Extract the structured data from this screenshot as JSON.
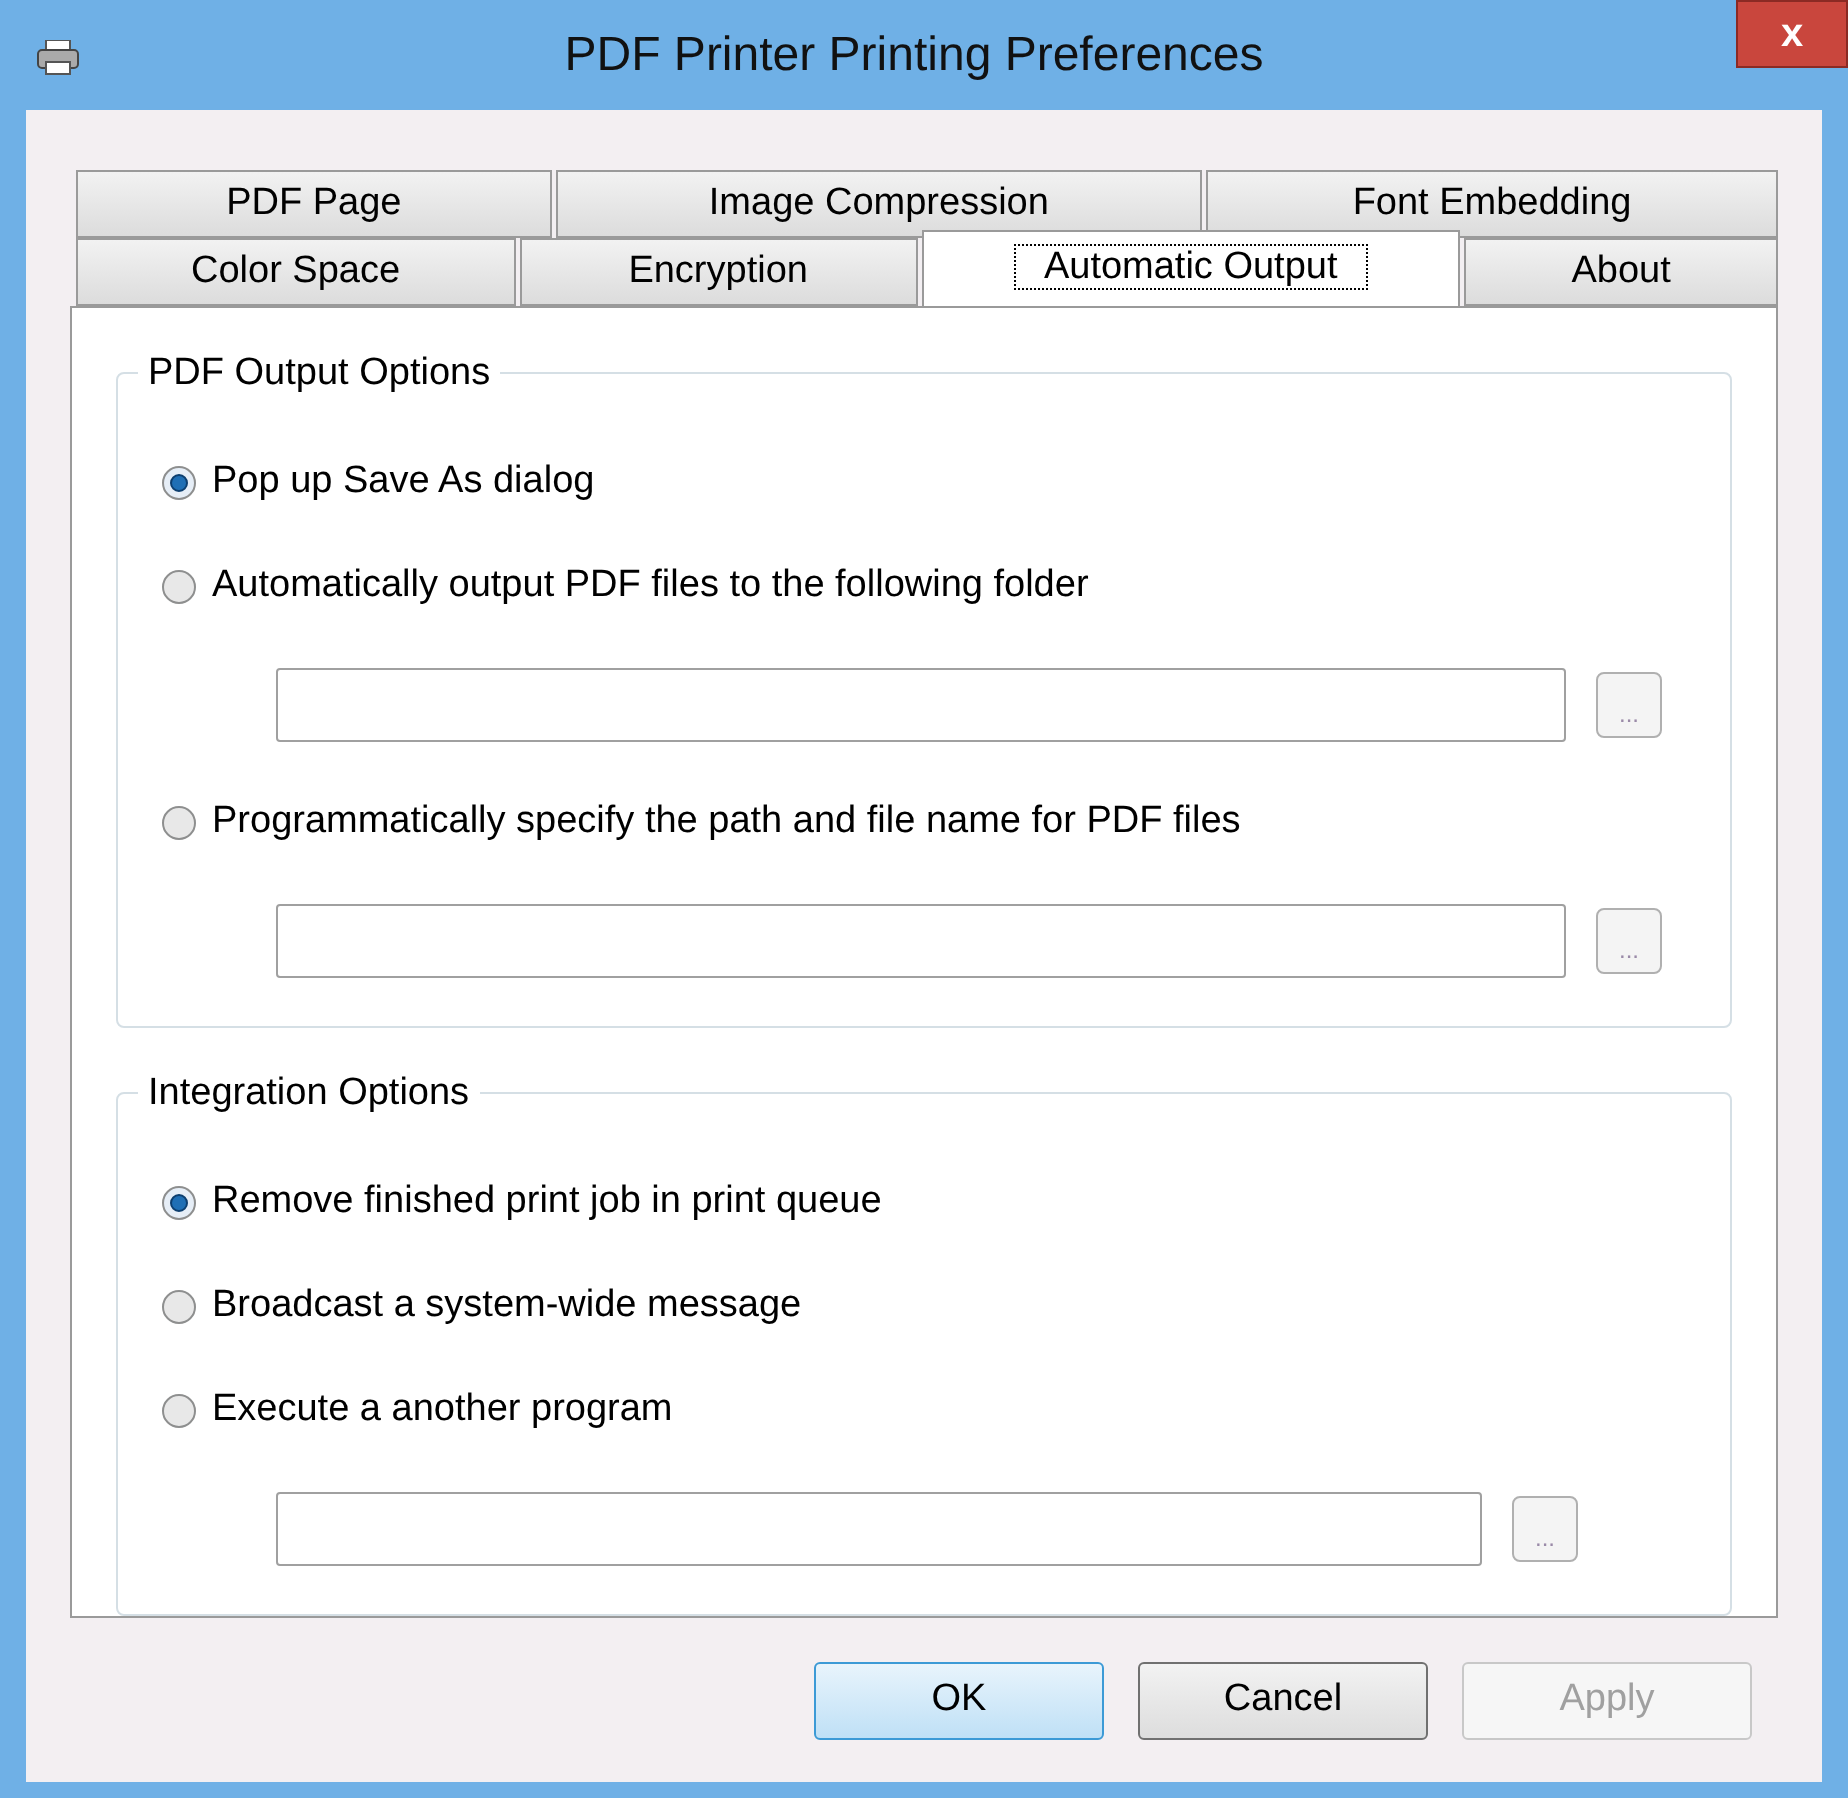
{
  "window": {
    "title": "PDF Printer Printing Preferences",
    "close_label": "x"
  },
  "tab_rows": [
    [
      {
        "label": "PDF Page",
        "selected": false
      },
      {
        "label": "Image Compression",
        "selected": false
      },
      {
        "label": "Font Embedding",
        "selected": false
      }
    ],
    [
      {
        "label": "Color Space",
        "selected": false
      },
      {
        "label": "Encryption",
        "selected": false
      },
      {
        "label": "Automatic Output",
        "selected": true
      },
      {
        "label": "About",
        "selected": false
      }
    ]
  ],
  "groups": [
    {
      "title": "PDF Output Options",
      "items": [
        {
          "kind": "radio",
          "label": "Pop up Save As dialog",
          "selected": true
        },
        {
          "kind": "radio",
          "label": "Automatically output PDF files to the following folder",
          "selected": false
        },
        {
          "kind": "path",
          "button": "..."
        },
        {
          "kind": "radio",
          "label": "Programmatically specify the path and file name for PDF files",
          "selected": false
        },
        {
          "kind": "path",
          "button": "..."
        }
      ]
    },
    {
      "title": "Integration Options",
      "items": [
        {
          "kind": "radio",
          "label": "Remove finished print job in print queue",
          "selected": true
        },
        {
          "kind": "radio",
          "label": "Broadcast a system-wide message",
          "selected": false
        },
        {
          "kind": "radio",
          "label": "Execute a another program",
          "selected": false
        },
        {
          "kind": "path",
          "button": "..."
        }
      ]
    }
  ],
  "buttons": [
    {
      "label": "OK",
      "default": true,
      "disabled": false
    },
    {
      "label": "Cancel",
      "default": false,
      "disabled": false
    },
    {
      "label": "Apply",
      "default": false,
      "disabled": true
    }
  ]
}
